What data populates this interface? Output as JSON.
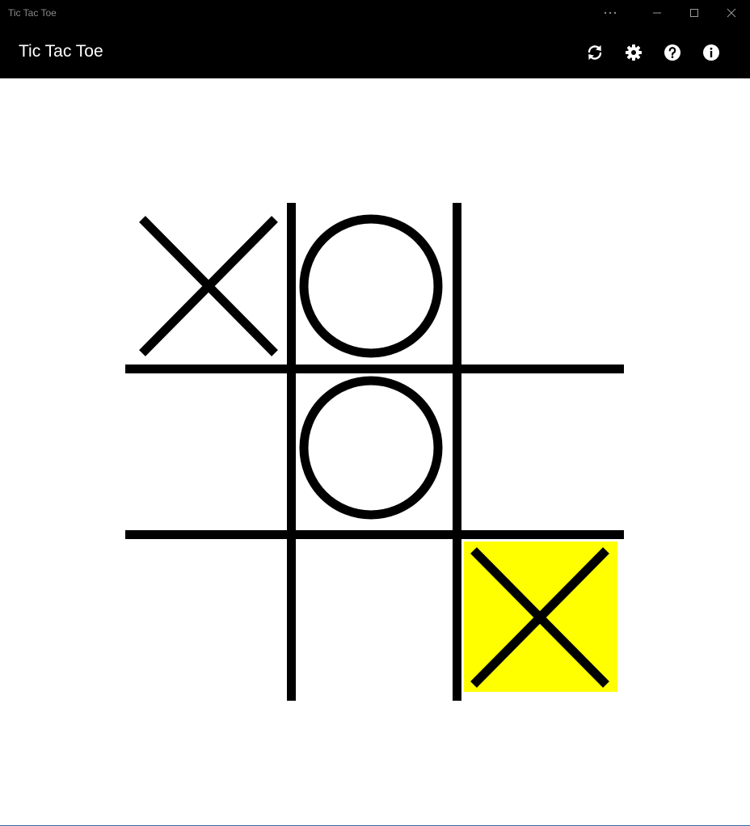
{
  "window": {
    "title": "Tic Tac Toe",
    "controls": [
      "more-icon",
      "minimize-icon",
      "maximize-icon",
      "close-icon"
    ]
  },
  "appbar": {
    "title": "Tic Tac Toe",
    "actions": [
      {
        "name": "restart",
        "icon": "refresh-icon"
      },
      {
        "name": "settings",
        "icon": "gear-icon"
      },
      {
        "name": "help",
        "icon": "help-icon"
      },
      {
        "name": "info",
        "icon": "info-icon"
      }
    ]
  },
  "game": {
    "board": [
      [
        "X",
        "O",
        ""
      ],
      [
        "",
        "O",
        ""
      ],
      [
        "",
        "",
        "X"
      ]
    ],
    "highlighted_cells": [
      [
        2,
        2
      ]
    ]
  },
  "colors": {
    "chrome": "#000000",
    "board_line": "#000000",
    "mark": "#000000",
    "highlight": "#ffff00",
    "background": "#ffffff"
  }
}
